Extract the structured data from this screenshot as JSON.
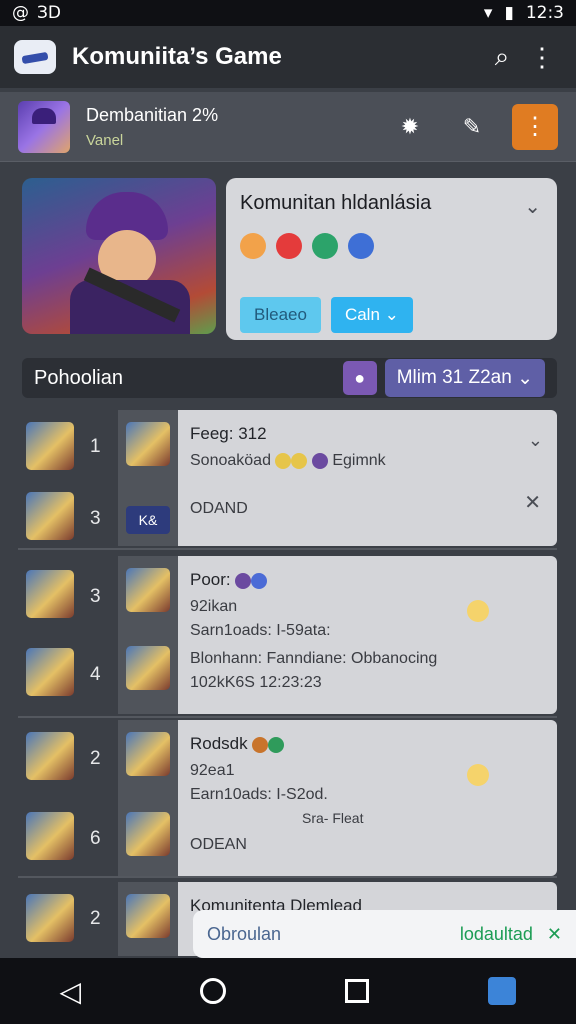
{
  "status": {
    "left1": "@",
    "left2": "ЗD",
    "time": "12:3"
  },
  "appbar": {
    "title": "Komuniita’s Game"
  },
  "banner": {
    "name": "Dembanitian 2%",
    "sub": "Vanel"
  },
  "hero": {
    "card_title": "Komunitan hldanlásia",
    "btn1": "Bleaeo",
    "btn2": "Caln"
  },
  "filter": {
    "label": "Pohoolian",
    "dropdown": "Mlim 31 Z2an"
  },
  "groups": [
    {
      "rows": [
        {
          "num": "1"
        },
        {
          "num": "3"
        }
      ],
      "tag": "K&",
      "title": "Feeg: 312",
      "line2": "Sonoaköad",
      "line2b": "Egimnk",
      "line3": "ODAND"
    },
    {
      "rows": [
        {
          "num": "3"
        },
        {
          "num": "4"
        }
      ],
      "title": "Poor:",
      "line2": "92ikan",
      "line3": "Sarn1oads: I-59ata:",
      "line4": "Blonhann: Fanndiane: Obbanocing",
      "line5": "102kK6S   12:23:23"
    },
    {
      "rows": [
        {
          "num": "2"
        },
        {
          "num": "6"
        }
      ],
      "title": "Rodsdk",
      "line2": "92ea1",
      "line3": "Earn10ads: I-S2od.",
      "line4": "Sra- Fleat",
      "line5": "ODEAN"
    },
    {
      "rows": [
        {
          "num": "2"
        }
      ],
      "title": "Komunitenta Dlemlead"
    }
  ],
  "toast": {
    "left": "Obroulan",
    "right": "lodaultad"
  }
}
